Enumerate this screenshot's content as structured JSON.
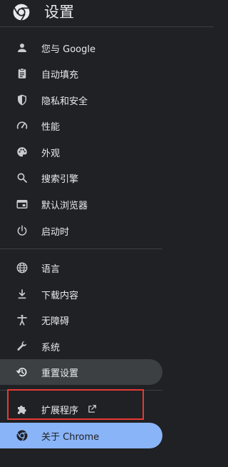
{
  "header": {
    "title": "设置",
    "logo_icon": "chrome-icon"
  },
  "colors": {
    "background": "#202124",
    "text": "#e8eaed",
    "icon": "#c9cccf",
    "hover_background": "#3c4043",
    "selected_background": "#8ab4f8",
    "highlight_border": "#e53935"
  },
  "nav": {
    "items": [
      {
        "label": "您与 Google",
        "icon": "person-icon"
      },
      {
        "label": "自动填充",
        "icon": "clipboard-icon"
      },
      {
        "label": "隐私和安全",
        "icon": "shield-icon"
      },
      {
        "label": "性能",
        "icon": "speedometer-icon"
      },
      {
        "label": "外观",
        "icon": "palette-icon"
      },
      {
        "label": "搜索引擎",
        "icon": "search-icon"
      },
      {
        "label": "默认浏览器",
        "icon": "browser-window-icon"
      },
      {
        "label": "启动时",
        "icon": "power-icon"
      },
      {
        "label": "语言",
        "icon": "globe-icon"
      },
      {
        "label": "下载内容",
        "icon": "download-icon"
      },
      {
        "label": "无障碍",
        "icon": "accessibility-icon"
      },
      {
        "label": "系统",
        "icon": "wrench-icon"
      },
      {
        "label": "重置设置",
        "icon": "reset-history-icon",
        "state": "hovered"
      },
      {
        "label": "扩展程序",
        "icon": "puzzle-icon",
        "trailing_icon": "open-in-new-icon"
      },
      {
        "label": "关于 Chrome",
        "icon": "chrome-icon",
        "state": "selected"
      }
    ]
  }
}
